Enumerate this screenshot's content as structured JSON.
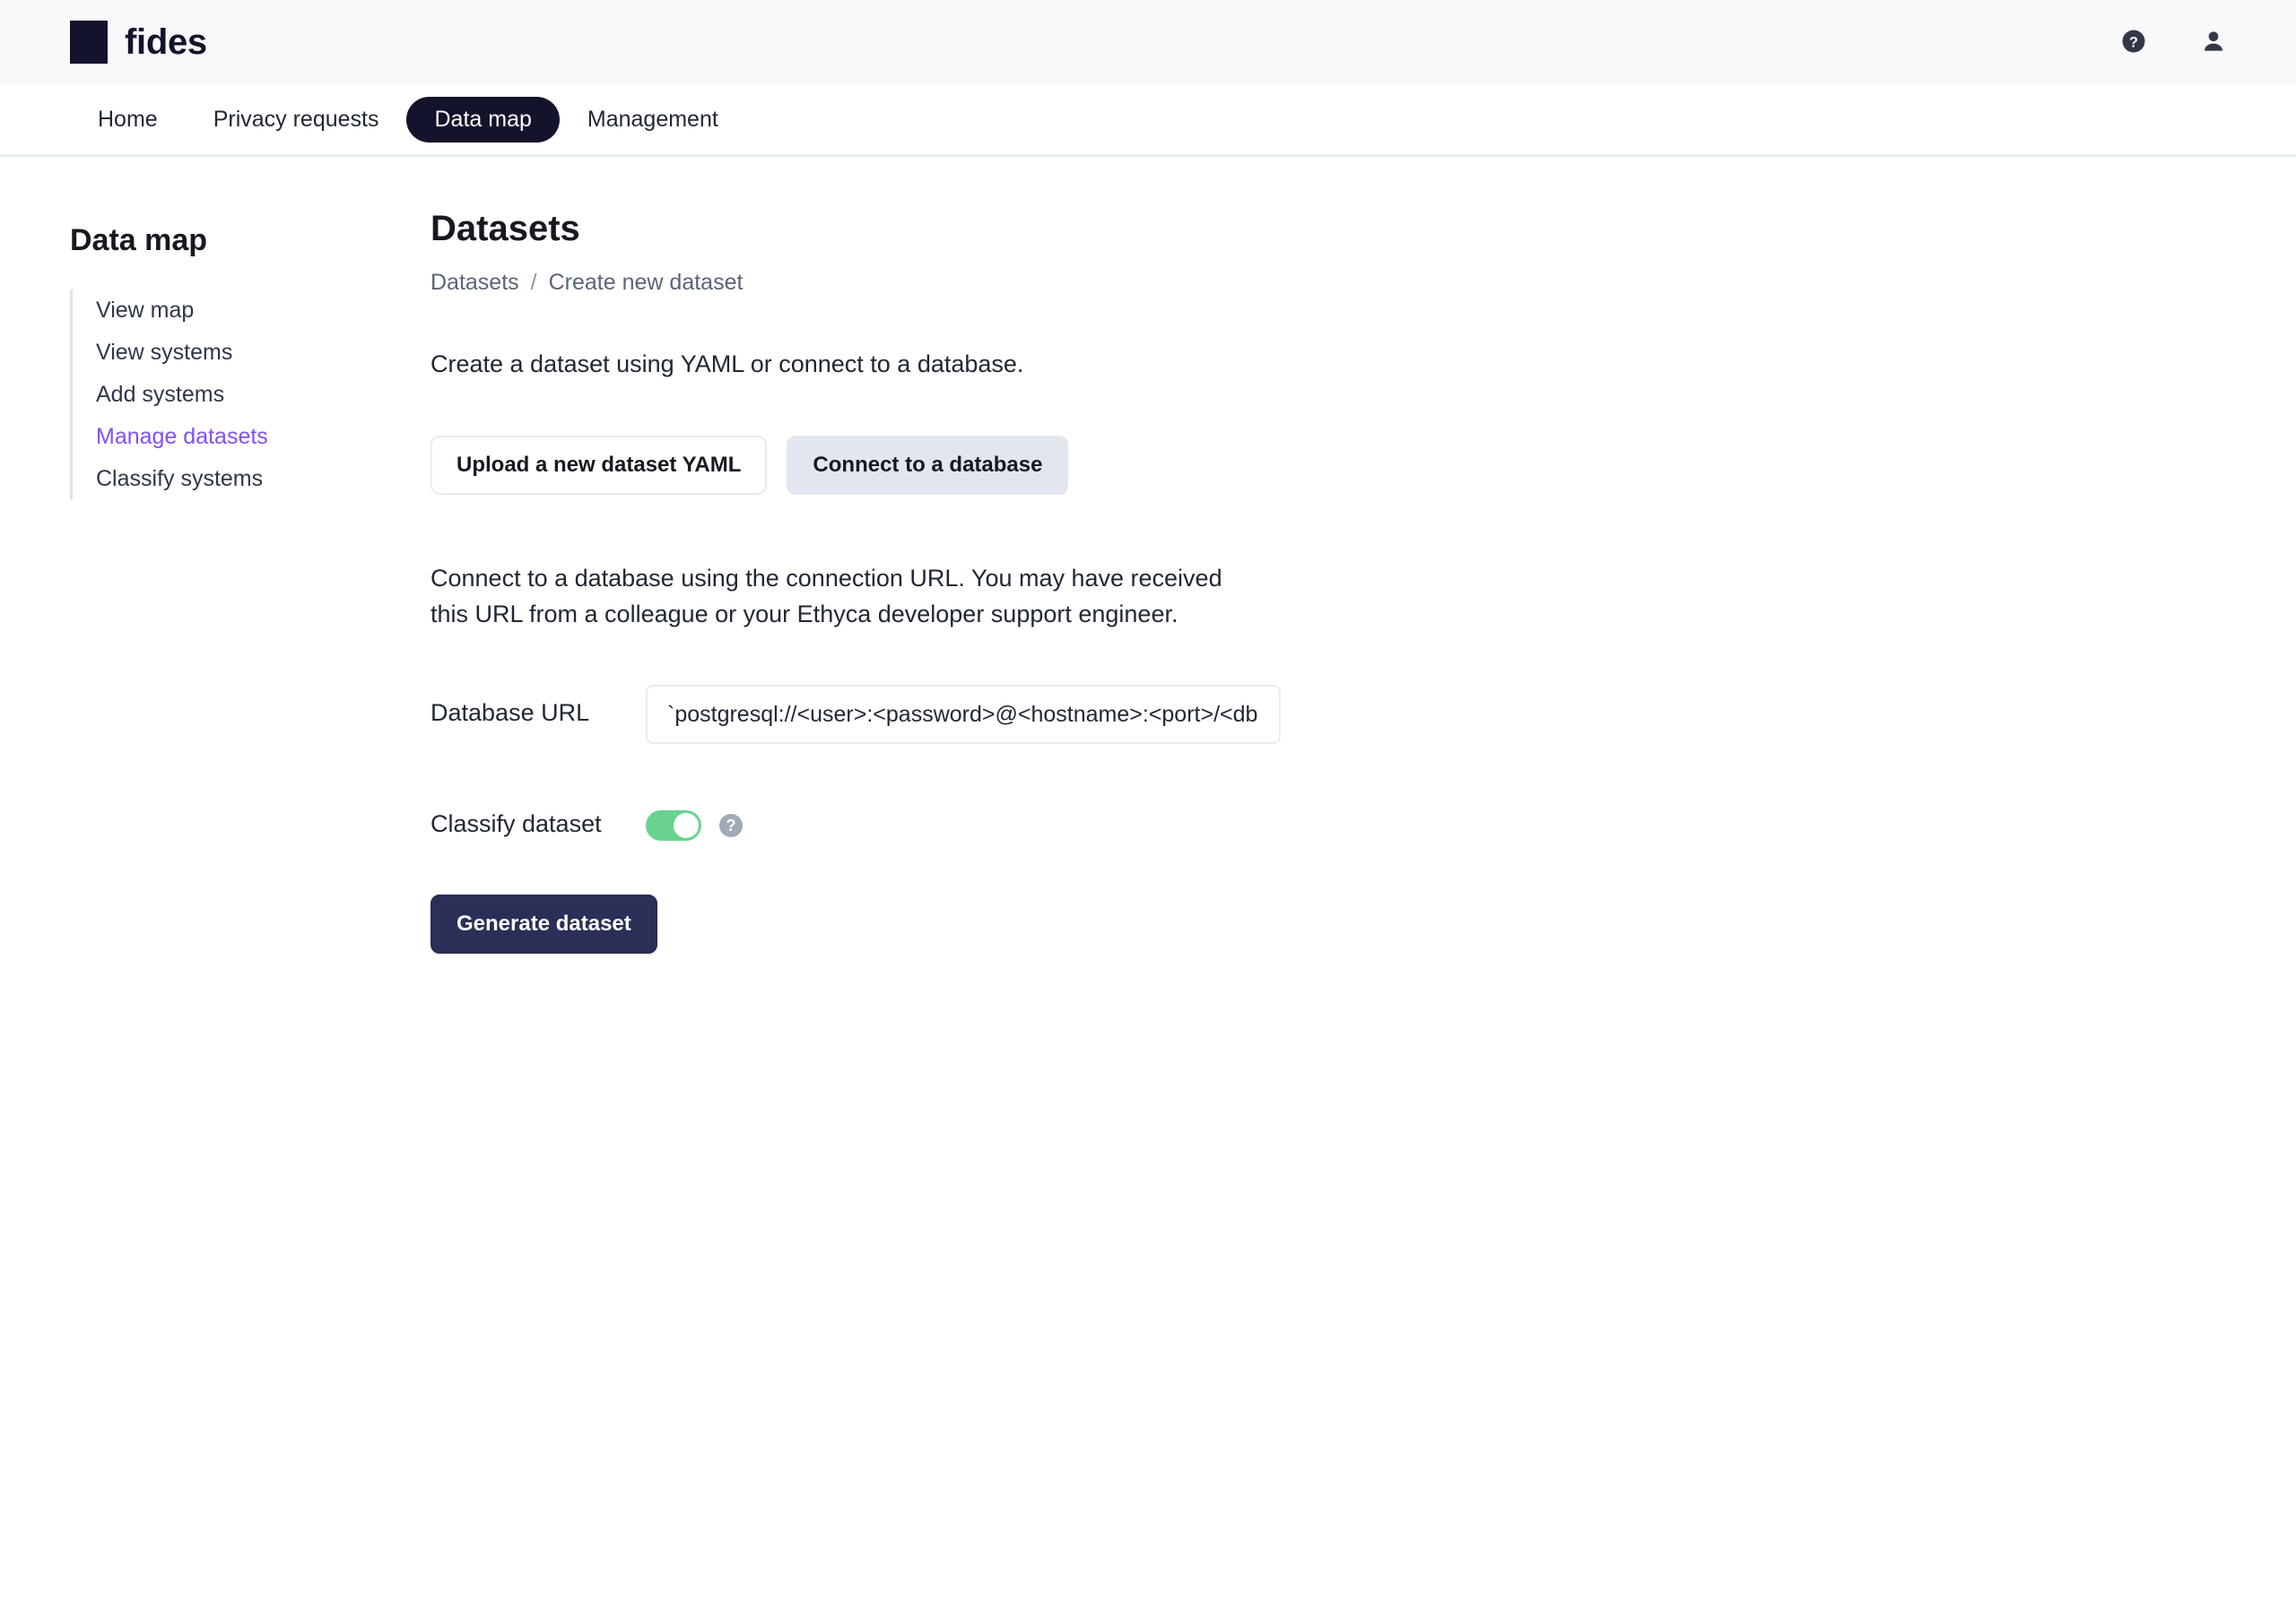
{
  "brand": {
    "name": "fides",
    "logo_icon": "square-logo-icon",
    "help_icon": "help-circle-icon",
    "account_icon": "user-account-icon",
    "logo_color": "#13132B"
  },
  "nav": {
    "items": [
      {
        "label": "Home",
        "active": false
      },
      {
        "label": "Privacy requests",
        "active": false
      },
      {
        "label": "Data map",
        "active": true
      },
      {
        "label": "Management",
        "active": false
      }
    ],
    "active_bg": "#13132B"
  },
  "sidebar": {
    "title": "Data map",
    "items": [
      {
        "label": "View map",
        "active": false
      },
      {
        "label": "View systems",
        "active": false
      },
      {
        "label": "Add systems",
        "active": false
      },
      {
        "label": "Manage datasets",
        "active": true
      },
      {
        "label": "Classify systems",
        "active": false
      }
    ],
    "active_color": "#8250F4"
  },
  "main": {
    "title": "Datasets",
    "breadcrumb": {
      "root": "Datasets",
      "separator": "/",
      "current": "Create new dataset"
    },
    "intro": "Create a dataset using YAML or connect to a database.",
    "tabs": {
      "upload_yaml": "Upload a new dataset YAML",
      "connect_database": "Connect to a database",
      "selected": "Connect to a database"
    },
    "description": "Connect to a database using the connection URL. You may have received this URL from a colleague or your Ethyca developer support engineer.",
    "form": {
      "url_label": "Database URL",
      "url_value": "",
      "url_placeholder": "`postgresql://<user>:<password>@<hostname>:<port>/<dbname>`",
      "classify_label": "Classify dataset",
      "classify_enabled": true,
      "classify_help_icon": "question-mark-icon",
      "toggle_on_color": "#68D391",
      "submit_label": "Generate dataset"
    }
  }
}
